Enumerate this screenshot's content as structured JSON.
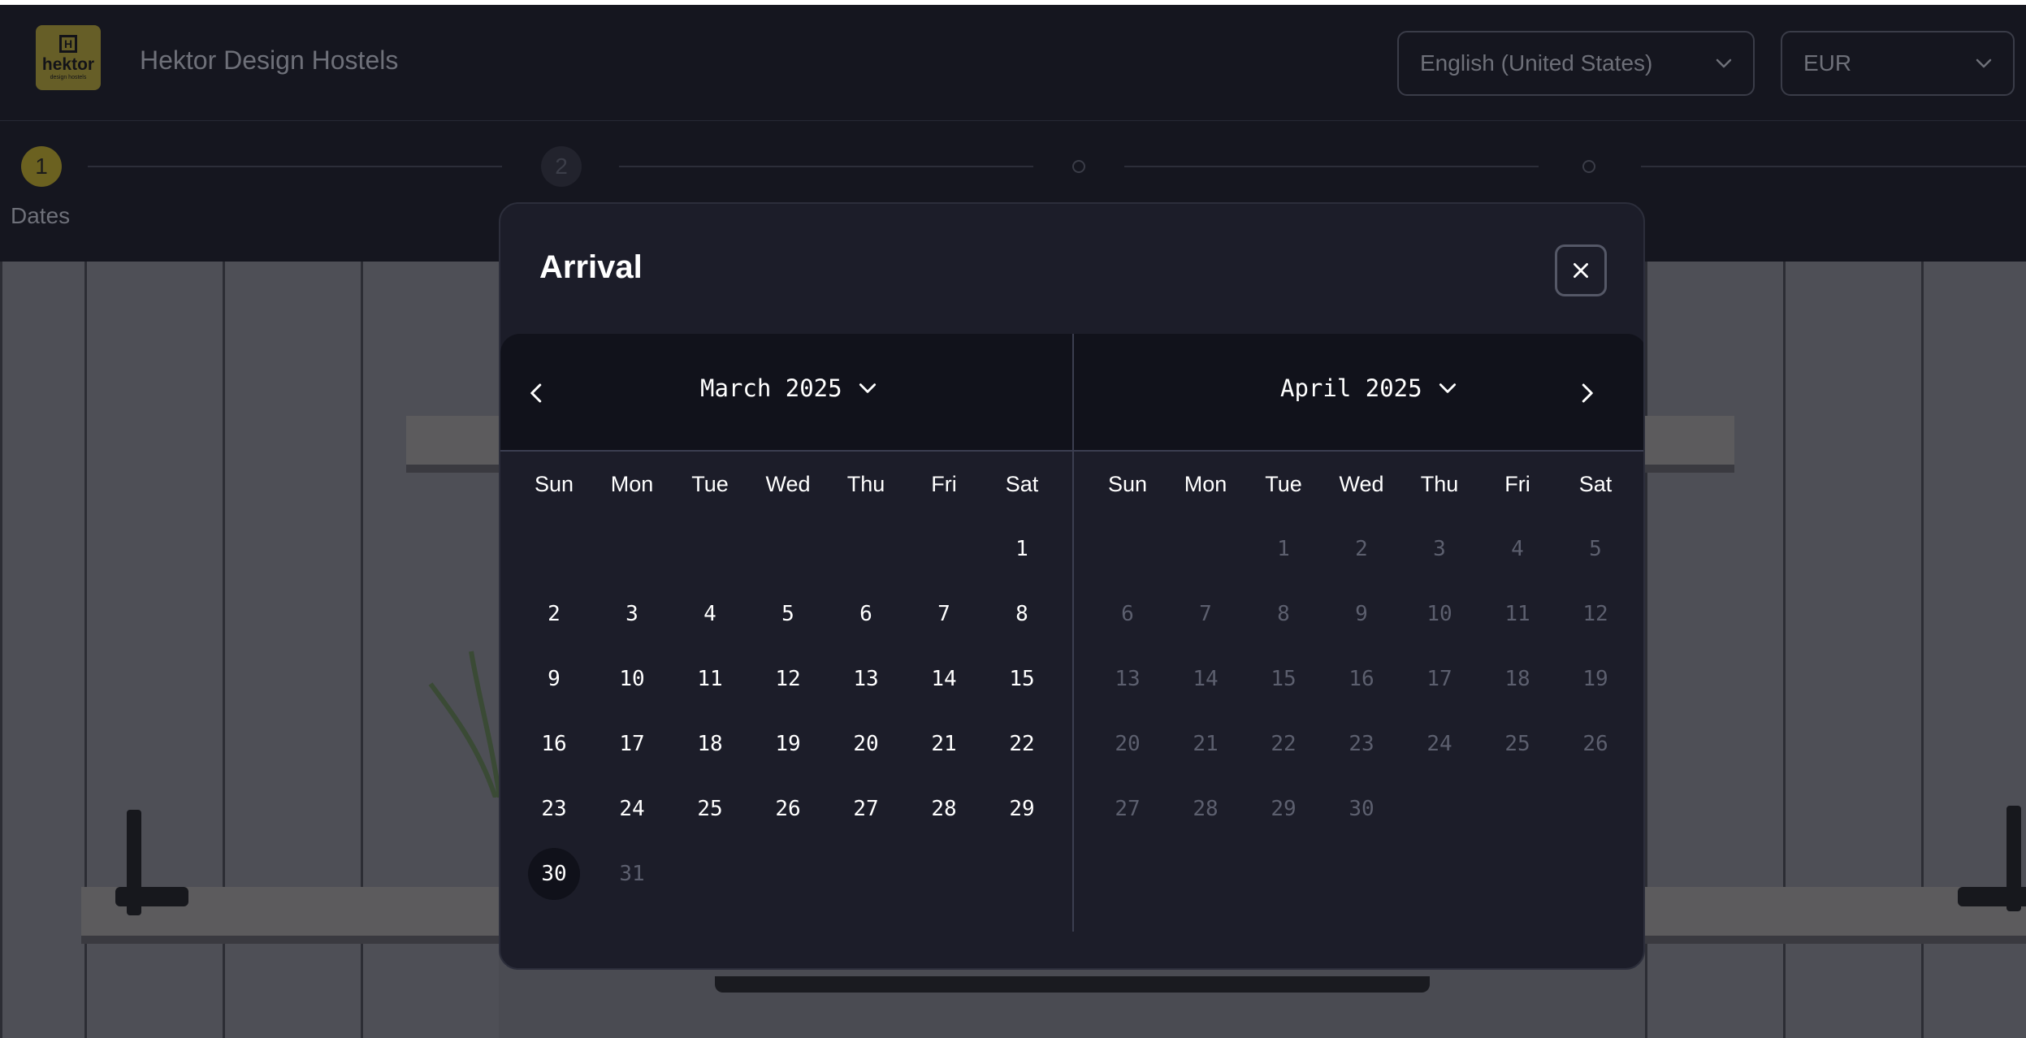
{
  "header": {
    "brand_name": "Hektor Design Hostels",
    "logo": {
      "mark": "H",
      "word": "hektor",
      "sub": "design hostels"
    },
    "language": {
      "selected": "English (United States)"
    },
    "currency": {
      "selected": "EUR"
    }
  },
  "stepper": {
    "steps": [
      {
        "number": "1",
        "label": "Dates"
      },
      {
        "number": "2"
      }
    ]
  },
  "modal": {
    "title": "Arrival",
    "weekdays": [
      "Sun",
      "Mon",
      "Tue",
      "Wed",
      "Thu",
      "Fri",
      "Sat"
    ],
    "months": [
      {
        "label": "March 2025",
        "leading_blanks": 6,
        "days": [
          {
            "d": "1"
          },
          {
            "d": "2"
          },
          {
            "d": "3"
          },
          {
            "d": "4"
          },
          {
            "d": "5"
          },
          {
            "d": "6"
          },
          {
            "d": "7"
          },
          {
            "d": "8"
          },
          {
            "d": "9"
          },
          {
            "d": "10"
          },
          {
            "d": "11"
          },
          {
            "d": "12"
          },
          {
            "d": "13"
          },
          {
            "d": "14"
          },
          {
            "d": "15"
          },
          {
            "d": "16"
          },
          {
            "d": "17"
          },
          {
            "d": "18"
          },
          {
            "d": "19"
          },
          {
            "d": "20"
          },
          {
            "d": "21"
          },
          {
            "d": "22"
          },
          {
            "d": "23"
          },
          {
            "d": "24"
          },
          {
            "d": "25"
          },
          {
            "d": "26"
          },
          {
            "d": "27"
          },
          {
            "d": "28"
          },
          {
            "d": "29"
          },
          {
            "d": "30",
            "selected": true
          },
          {
            "d": "31",
            "disabled": true
          }
        ]
      },
      {
        "label": "April 2025",
        "leading_blanks": 2,
        "days": [
          {
            "d": "1",
            "disabled": true
          },
          {
            "d": "2",
            "disabled": true
          },
          {
            "d": "3",
            "disabled": true
          },
          {
            "d": "4",
            "disabled": true
          },
          {
            "d": "5",
            "disabled": true
          },
          {
            "d": "6",
            "disabled": true
          },
          {
            "d": "7",
            "disabled": true
          },
          {
            "d": "8",
            "disabled": true
          },
          {
            "d": "9",
            "disabled": true
          },
          {
            "d": "10",
            "disabled": true
          },
          {
            "d": "11",
            "disabled": true
          },
          {
            "d": "12",
            "disabled": true
          },
          {
            "d": "13",
            "disabled": true
          },
          {
            "d": "14",
            "disabled": true
          },
          {
            "d": "15",
            "disabled": true
          },
          {
            "d": "16",
            "disabled": true
          },
          {
            "d": "17",
            "disabled": true
          },
          {
            "d": "18",
            "disabled": true
          },
          {
            "d": "19",
            "disabled": true
          },
          {
            "d": "20",
            "disabled": true
          },
          {
            "d": "21",
            "disabled": true
          },
          {
            "d": "22",
            "disabled": true
          },
          {
            "d": "23",
            "disabled": true
          },
          {
            "d": "24",
            "disabled": true
          },
          {
            "d": "25",
            "disabled": true
          },
          {
            "d": "26",
            "disabled": true
          },
          {
            "d": "27",
            "disabled": true
          },
          {
            "d": "28",
            "disabled": true
          },
          {
            "d": "29",
            "disabled": true
          },
          {
            "d": "30",
            "disabled": true
          }
        ]
      }
    ]
  },
  "colors": {
    "background": "#15161f",
    "modal_bg": "#1c1d29",
    "calendar_header_bg": "#11121b",
    "accent_step": "#6b6120",
    "logo_yellow": "#c9b531",
    "disabled_text": "#5c5f6e"
  },
  "icons": {
    "close": "close-icon",
    "prev": "chevron-left-icon",
    "next": "chevron-right-icon",
    "dropdown": "chevron-down-icon"
  }
}
